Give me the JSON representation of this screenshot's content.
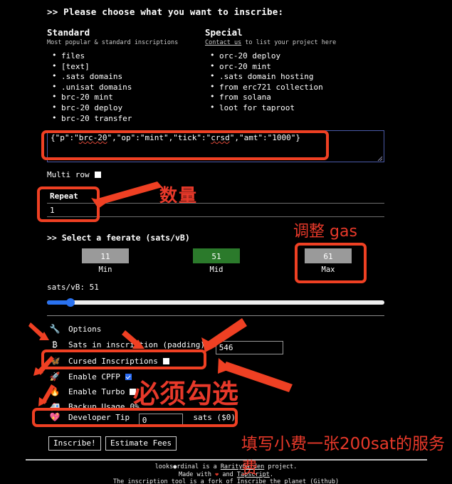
{
  "headline": ">> Please choose what you want to inscribe:",
  "standard": {
    "title": "Standard",
    "subtitle": "Most popular & standard inscriptions",
    "items": [
      "files",
      "[text]",
      ".sats domains",
      ".unisat domains",
      "brc-20 mint",
      "brc-20 deploy",
      "brc-20 transfer"
    ]
  },
  "special": {
    "title": "Special",
    "contact_link": "Contact us",
    "subtitle_rest": " to list your project here",
    "items": [
      "orc-20 deploy",
      "orc-20 mint",
      ".sats domain hosting",
      "from erc721 collection",
      "from solana",
      "loot for taproot"
    ]
  },
  "inscription": {
    "textarea_value": "{\"p\":\"brc-20\",\"op\":\"mint\",\"tick\":\"crsd\",\"amt\":\"1000\"}",
    "seg_1": "{\"p\":\"",
    "seg_misspelled_1": "brc-20",
    "seg_2": "\",\"op\":\"mint\",\"tick\":\"",
    "seg_misspelled_2": "crsd",
    "seg_3": "\",\"amt\":\"1000\"}",
    "multi_row_label": "Multi row",
    "multi_row_checked": false,
    "repeat_label": "Repeat",
    "repeat_value": "1"
  },
  "feerate": {
    "heading": ">> Select a feerate (sats/vB)",
    "options": [
      {
        "value": "11",
        "caption": "Min",
        "selected": false
      },
      {
        "value": "51",
        "caption": "Mid",
        "selected": true
      },
      {
        "value": "61",
        "caption": "Max",
        "selected": false
      }
    ],
    "current_label": "sats/vB: 51",
    "slider_percent": 7
  },
  "options": {
    "heading": "Options",
    "heading_icon": "wrench-icon",
    "rows": [
      {
        "icon": "₿",
        "icon_name": "bitcoin-icon",
        "label": "Sats in inscription (padding)",
        "input_value": "546"
      },
      {
        "icon": "🦋",
        "icon_name": "butterfly-icon",
        "label": "Cursed Inscriptions",
        "checked": false
      },
      {
        "icon": "🚀",
        "icon_name": "rocket-icon",
        "label": "Enable CPFP",
        "checked": true
      },
      {
        "icon": "🔥",
        "icon_name": "fire-icon",
        "label": "Enable Turbo",
        "checked": false
      },
      {
        "icon": "🚑",
        "icon_name": "ambulance-icon",
        "label": "Backup Usage",
        "suffix": "0%"
      },
      {
        "icon": "💖",
        "icon_name": "sparkling-heart-icon",
        "label": "Developer Tip",
        "input_value": "0",
        "suffix": "sats ($0)"
      }
    ]
  },
  "actions": {
    "inscribe_label": "Inscribe!",
    "estimate_label": "Estimate Fees"
  },
  "footer": {
    "line1_a": "looks●rdinal is a ",
    "line1_link": "RarityGarden",
    "line1_b": " project.",
    "line2_a": "Made with ",
    "line2_heart": "❤",
    "line2_b": " and ",
    "line2_link": "Tapscript",
    "line2_c": ".",
    "line3": "The inscription tool is a fork of Inscribe the planet (Github)"
  },
  "annotations": {
    "color": "#ef4023",
    "quantity": "数量",
    "adjust_gas": "调整 gas",
    "must_check": "必须勾选",
    "tip_note": "填写小费一张200sat的服务费"
  }
}
